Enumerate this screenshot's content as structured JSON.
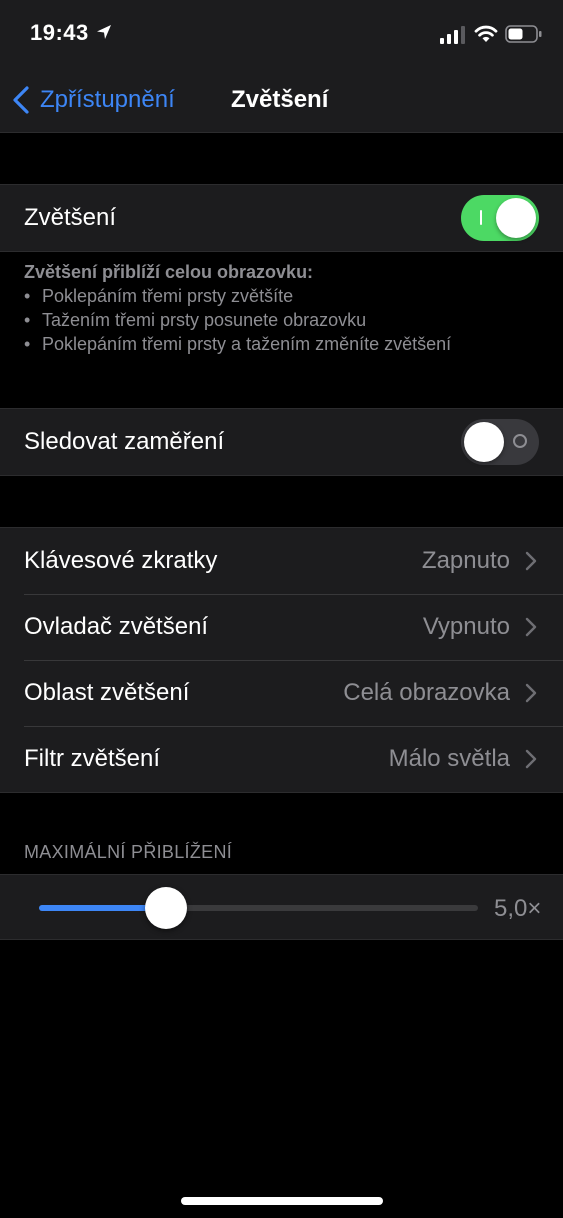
{
  "status_bar": {
    "time": "19:43"
  },
  "nav": {
    "back_label": "Zpřístupnění",
    "title": "Zvětšení"
  },
  "zoom_group": {
    "label": "Zvětšení",
    "toggle_on": true
  },
  "description": {
    "title": "Zvětšení přiblíží celou obrazovku:",
    "items": [
      "Poklepáním třemi prsty zvětšíte",
      "Tažením třemi prsty posunete obrazovku",
      "Poklepáním třemi prsty a tažením změníte zvětšení"
    ]
  },
  "follow_focus": {
    "label": "Sledovat zaměření",
    "toggle_on": false
  },
  "settings_rows": [
    {
      "label": "Klávesové zkratky",
      "value": "Zapnuto"
    },
    {
      "label": "Ovladač zvětšení",
      "value": "Vypnuto"
    },
    {
      "label": "Oblast zvětšení",
      "value": "Celá obrazovka"
    },
    {
      "label": "Filtr zvětšení",
      "value": "Málo světla"
    }
  ],
  "max_zoom": {
    "header": "MAXIMÁLNÍ PŘIBLÍŽENÍ",
    "value_label": "5,0×",
    "slider_fraction": 0.29
  },
  "colors": {
    "accent": "#3d86f6",
    "toggle_on": "#4cd964",
    "background": "#000000",
    "cell": "#1c1c1e",
    "secondary_text": "#8e8e93"
  }
}
